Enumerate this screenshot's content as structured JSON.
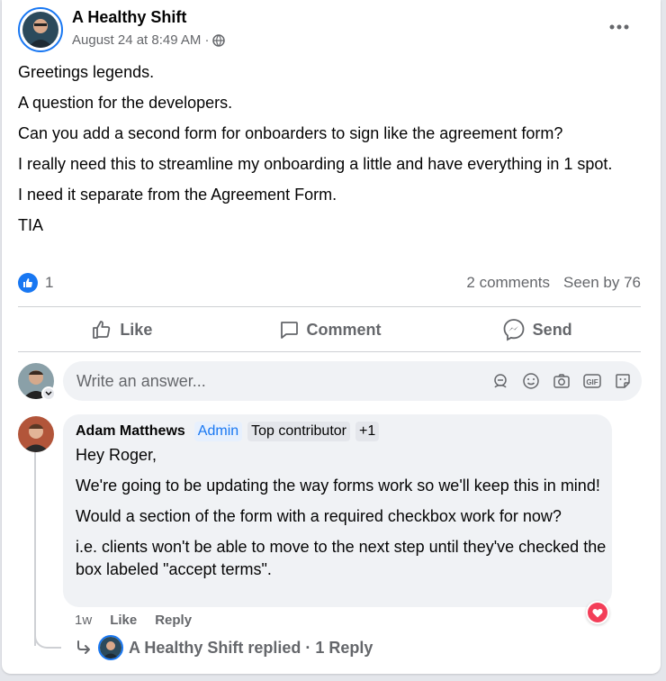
{
  "post": {
    "author": "A Healthy Shift",
    "timestamp": "August 24 at 8:49 AM",
    "privacy_icon": "globe-icon",
    "more_icon": "more-horizontal-icon",
    "body": [
      "Greetings legends.",
      "A question for the developers.",
      "Can you add a second form for onboarders to sign like the agreement form?",
      "I really need this to streamline my onboarding a little and have everything in 1 spot.",
      "I need it separate from the Agreement Form.",
      "TIA"
    ]
  },
  "reactions": {
    "like_count": "1",
    "comments": "2 comments",
    "seen": "Seen by 76"
  },
  "actions": {
    "like": "Like",
    "comment": "Comment",
    "send": "Send"
  },
  "composer": {
    "placeholder": "Write an answer...",
    "icons": [
      "avatar-sticker-icon",
      "emoji-icon",
      "camera-icon",
      "gif-icon",
      "sticker-icon"
    ]
  },
  "comment": {
    "author": "Adam Matthews",
    "badges": [
      "Admin",
      "Top contributor",
      "+1"
    ],
    "text": [
      "Hey Roger,",
      "We're going to be updating the way forms work so we'll keep this in mind!",
      "Would a section of the form with a required checkbox work for now?",
      "i.e. clients won't be able to move to the next step until they've checked the box labeled \"accept terms\"."
    ],
    "age": "1w",
    "like": "Like",
    "reply": "Reply",
    "replied_summary": "A Healthy Shift replied · 1 Reply"
  },
  "colors": {
    "brand": "#1877f2",
    "heart": "#f33e58",
    "muted": "#65676b"
  }
}
